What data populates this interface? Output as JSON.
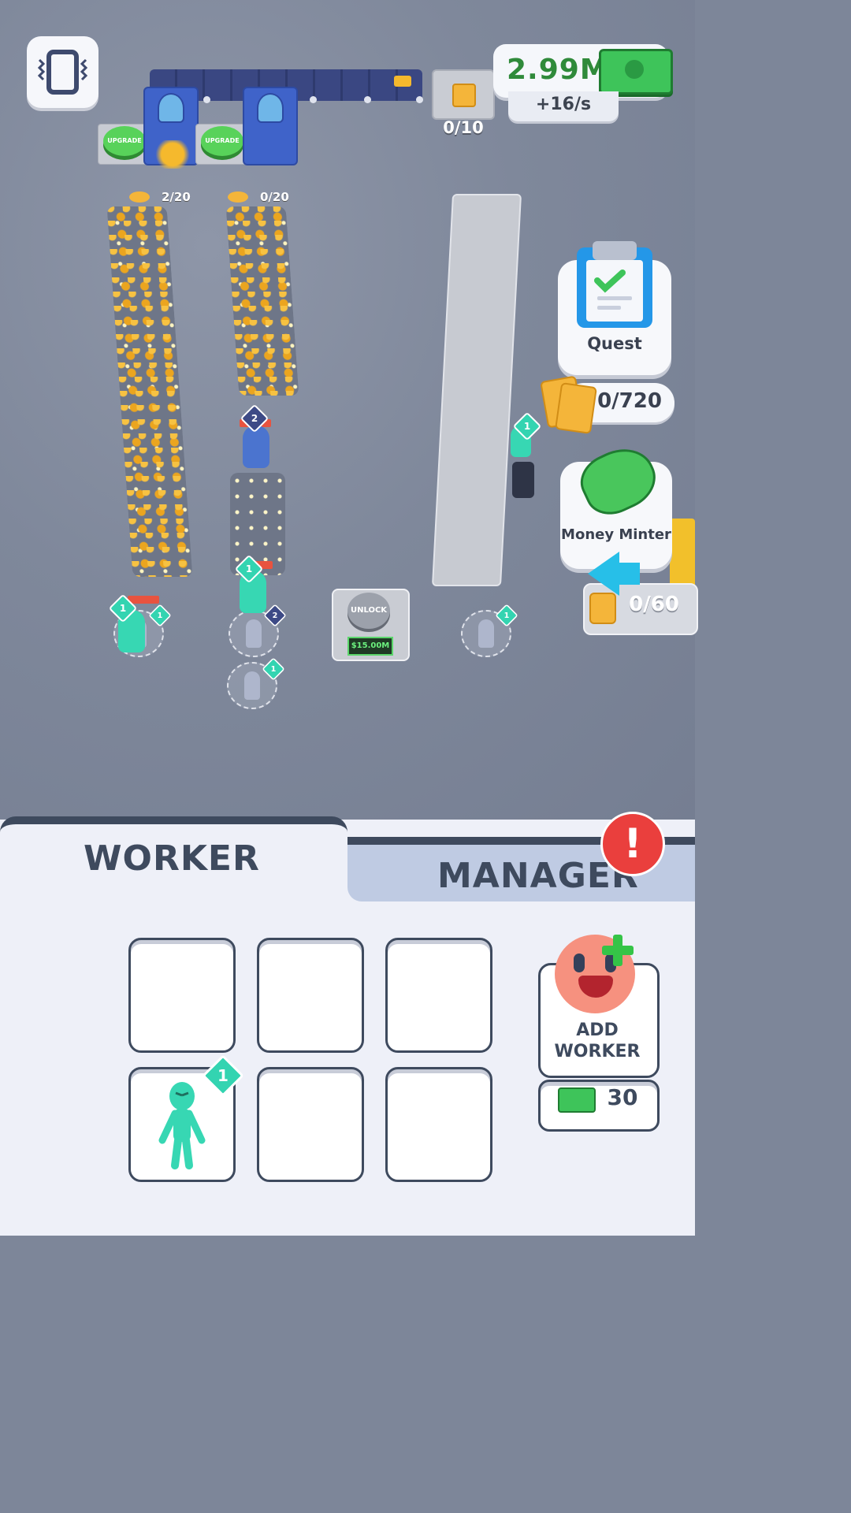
{
  "hud": {
    "money": "2.99M",
    "rate": "+16/s",
    "conveyor_slot_count": "0/10",
    "lane1_count": "2/20",
    "lane2_count": "0/20",
    "upgrade_label": "UPGRADE",
    "unlock_label": "UNLOCK",
    "unlock_price": "$15.00M"
  },
  "side": {
    "quest_label": "Quest",
    "tickets_count": "0/720",
    "minter_label": "Money Minter",
    "output_count": "0/60"
  },
  "workers_on_field": [
    {
      "level": "1"
    },
    {
      "level": "1"
    },
    {
      "level": "2"
    },
    {
      "level": "1"
    },
    {
      "level": "1"
    },
    {
      "level": "2"
    },
    {
      "level": "1"
    },
    {
      "level": "1"
    }
  ],
  "tabs": {
    "worker": "WORKER",
    "manager": "MANAGER",
    "alert": "!"
  },
  "inventory": {
    "slot_level": "1",
    "add_worker_label_1": "ADD",
    "add_worker_label_2": "WORKER",
    "add_worker_price": "30"
  },
  "colors": {
    "money_green": "#2f8a3a",
    "teal_badge": "#33d4b1",
    "navy_badge": "#3d4a86",
    "alert_red": "#ea3f3d",
    "panel_text": "#3e4a5e"
  }
}
